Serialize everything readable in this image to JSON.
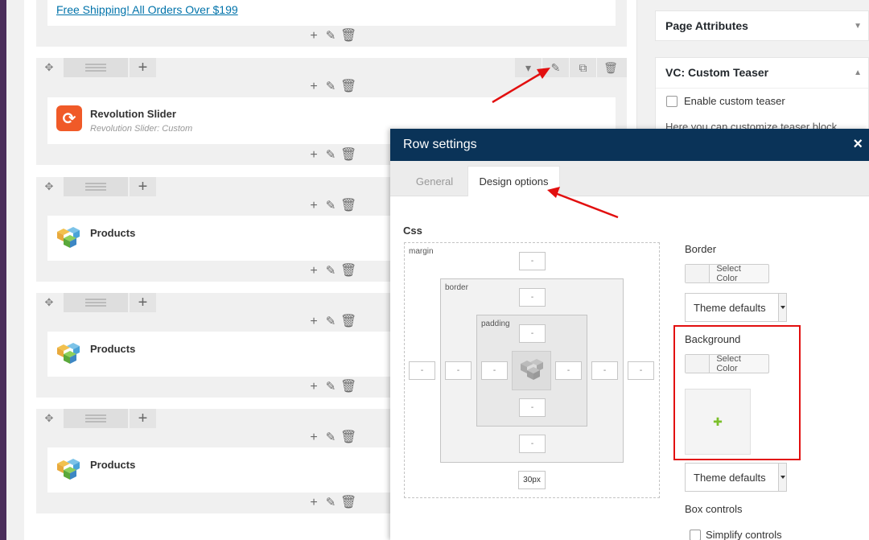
{
  "editor": {
    "shipping_link": "Free Shipping! All Orders Over $199",
    "revolution": {
      "title": "Revolution Slider",
      "subtitle": "Revolution Slider: Custom",
      "icon": "refresh-icon"
    },
    "products": [
      {
        "title": "Products"
      },
      {
        "title": "Products"
      },
      {
        "title": "Products"
      }
    ],
    "icons": {
      "move": "move-icon",
      "layout": "layout-icon",
      "add": "+",
      "edit": "pencil-icon",
      "delete": "trash-icon",
      "clone": "copy-icon",
      "toggle": "chevron-down-icon"
    }
  },
  "sidebar": {
    "page_attributes": "Page Attributes",
    "vc_custom_teaser": "VC: Custom Teaser",
    "enable_custom_teaser": "Enable custom teaser",
    "teaser_text": "Here you can customize teaser block"
  },
  "modal": {
    "title": "Row settings",
    "close": "×",
    "tabs": {
      "general": "General",
      "design": "Design options"
    },
    "css_label": "Css",
    "box_labels": {
      "margin": "margin",
      "border": "border",
      "padding": "padding"
    },
    "dash": "-",
    "margin_bottom_value": "30px",
    "border_label": "Border",
    "background_label": "Background",
    "select_color": "Select Color",
    "theme_defaults": "Theme defaults",
    "box_controls": "Box controls",
    "simplify_controls": "Simplify controls"
  },
  "colors": {
    "modal_header": "#0a3358",
    "annotation_red": "#e20f0f",
    "link_blue": "#0073aa",
    "admin_purple": "#4b2e5b",
    "revolution_orange": "#f05a28"
  }
}
